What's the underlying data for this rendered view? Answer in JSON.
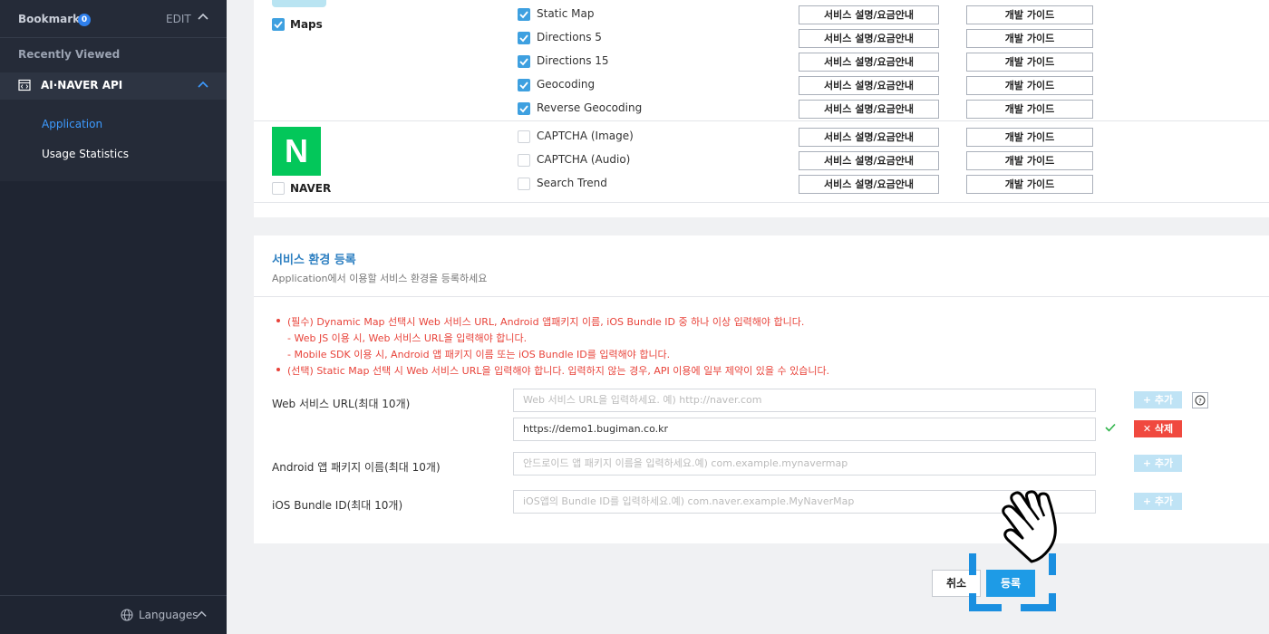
{
  "sidebar": {
    "bookmarks_label": "Bookmarks",
    "bookmarks_count": "0",
    "edit_label": "EDIT",
    "recently_viewed": "Recently Viewed",
    "api_section": "AI·NAVER API",
    "items": [
      {
        "label": "Application",
        "active": true
      },
      {
        "label": "Usage Statistics",
        "active": false
      }
    ],
    "languages": "Languages",
    "active_color": "#3d9bff"
  },
  "services": {
    "groups": [
      {
        "label": "Maps",
        "checked": true
      },
      {
        "label": "NAVER",
        "checked": false,
        "logo": "N"
      }
    ],
    "rows": [
      {
        "name": "Static Map",
        "checked": true
      },
      {
        "name": "Directions 5",
        "checked": true
      },
      {
        "name": "Directions 15",
        "checked": true
      },
      {
        "name": "Geocoding",
        "checked": true
      },
      {
        "name": "Reverse Geocoding",
        "checked": true
      },
      {
        "name": "CAPTCHA (Image)",
        "checked": false
      },
      {
        "name": "CAPTCHA (Audio)",
        "checked": false
      },
      {
        "name": "Search Trend",
        "checked": false
      }
    ],
    "desc_button": "서비스 설명/요금안내",
    "guide_button": "개발 가이드"
  },
  "env": {
    "title": "서비스 환경 등록",
    "subtitle": "Application에서 이용할 서비스 환경을 등록하세요",
    "notes": [
      "(필수) Dynamic Map 선택시 Web 서비스 URL, Android 앱패키지 이름, iOS Bundle ID 중 하나 이상 입력해야 합니다.",
      "- Web JS 이용 시, Web 서비스 URL을 입력해야 합니다.",
      "- Mobile SDK 이용 시, Android 앱 패키지 이름 또는 iOS Bundle ID를 입력해야 합니다.",
      "(선택) Static Map 선택 시 Web 서비스 URL을 입력해야 합니다. 입력하지 않는 경우, API 이용에 일부 제약이 있을 수 있습니다."
    ],
    "web": {
      "label": "Web 서비스 URL(최대 10개)",
      "placeholder": "Web 서비스 URL을 입력하세요. 예) http://naver.com",
      "value": "https://demo1.bugiman.co.kr"
    },
    "android": {
      "label": "Android 앱 패키지 이름(최대 10개)",
      "placeholder": "안드로이드 앱 패키지 이름을 입력하세요.예) com.example.mynavermap"
    },
    "ios": {
      "label": "iOS Bundle ID(최대 10개)",
      "placeholder": "iOS앱의 Bundle ID를 입력하세요.예) com.naver.example.MyNaverMap"
    },
    "add_label": "+ 추가",
    "delete_label": "✕ 삭제",
    "help_label": "?"
  },
  "actions": {
    "cancel": "취소",
    "submit": "등록"
  }
}
